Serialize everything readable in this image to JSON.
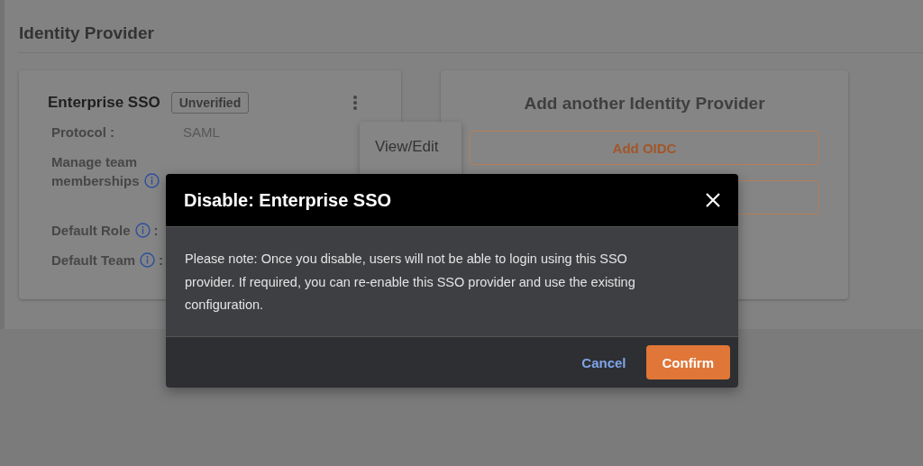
{
  "section_title": "Identity Provider",
  "provider_card": {
    "name": "Enterprise SSO",
    "badge": "Unverified",
    "fields": [
      {
        "label": "Protocol :",
        "info": false,
        "value": "SAML"
      },
      {
        "label": "Manage team memberships",
        "info": true
      },
      {
        "label": "Default Role",
        "info": true,
        "colon": ":"
      },
      {
        "label": "Default Team",
        "info": true,
        "colon": ":"
      }
    ]
  },
  "action_menu": {
    "items": [
      "View/Edit"
    ]
  },
  "add_card": {
    "title": "Add another Identity Provider",
    "buttons": [
      {
        "kind": "labeled",
        "label": "Add OIDC"
      },
      {
        "kind": "covered"
      }
    ]
  },
  "dialog": {
    "title": "Disable: Enterprise SSO",
    "message": "Please note: Once you disable, users will not be able to login using this SSO provider. If required, you can re-enable this SSO provider and use the existing configuration.",
    "buttons": [
      {
        "label": "Cancel",
        "kind": "link"
      },
      {
        "label": "Confirm",
        "kind": "primary"
      }
    ]
  }
}
